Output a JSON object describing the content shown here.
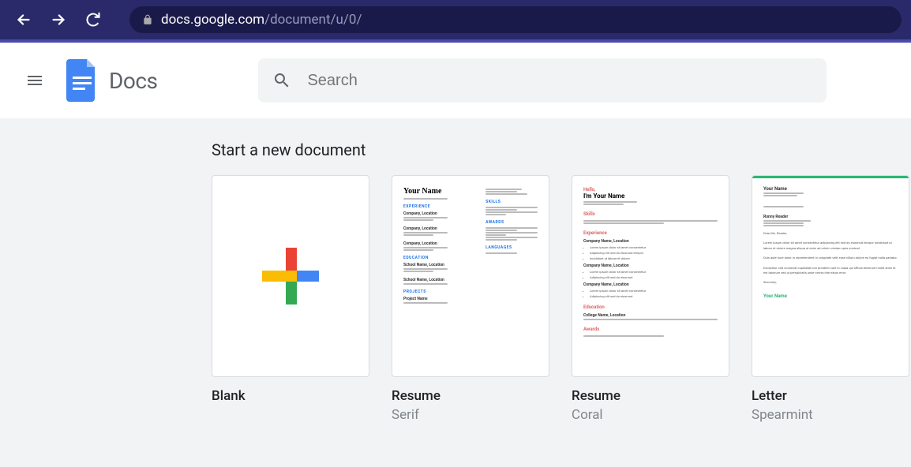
{
  "browser": {
    "url_domain": "docs.google.com",
    "url_path": "/document/u/0/"
  },
  "header": {
    "app_title": "Docs",
    "search_placeholder": "Search"
  },
  "section": {
    "title": "Start a new document"
  },
  "templates": [
    {
      "title": "Blank",
      "subtitle": ""
    },
    {
      "title": "Resume",
      "subtitle": "Serif"
    },
    {
      "title": "Resume",
      "subtitle": "Coral"
    },
    {
      "title": "Letter",
      "subtitle": "Spearmint"
    }
  ],
  "colors": {
    "google_blue": "#4285F4",
    "google_red": "#EA4335",
    "google_yellow": "#FBBC05",
    "google_green": "#34A853",
    "coral": "#E06666",
    "spearmint": "#2bb673"
  }
}
